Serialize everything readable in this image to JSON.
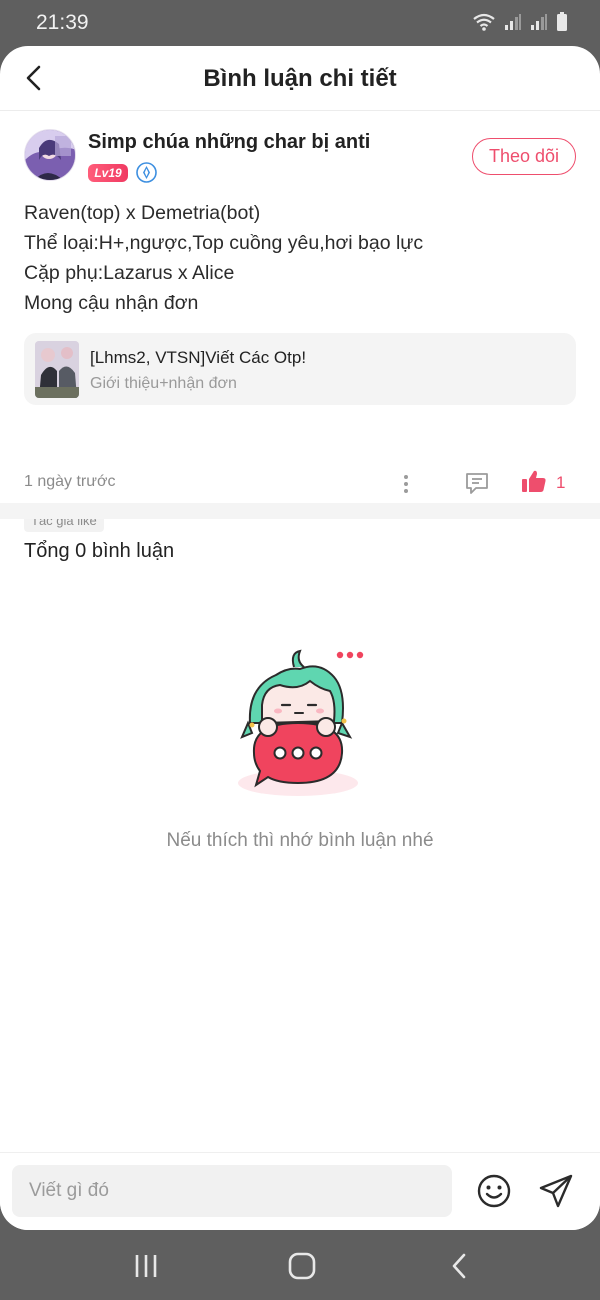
{
  "status_bar": {
    "time": "21:39",
    "icons": [
      "wifi-icon",
      "signal-icon",
      "signal-icon",
      "battery-icon"
    ]
  },
  "header": {
    "title": "Bình luận chi tiết",
    "back_icon": "chevron-left-icon"
  },
  "post": {
    "username": "Simp chúa những char bị anti",
    "level": "Lv19",
    "verify_icon": "verified-badge-icon",
    "follow_label": "Theo dõi",
    "body_lines": [
      "Raven(top) x Demetria(bot)",
      "Thể loại:H+,ngược,Top cuồng yêu,hơi bạo lực",
      "Cặp phụ:Lazarus x Alice",
      "Mong cậu nhận đơn"
    ],
    "link_card": {
      "title": "[Lhms2, VTSN]Viết Các Otp!",
      "subtitle": "Giới thiệu+nhận đơn"
    },
    "time_ago": "1 ngày trước",
    "like_count": "1",
    "author_like_tag": "Tác giả like"
  },
  "comments": {
    "total_label": "Tổng 0 bình luận",
    "empty_text": "Nếu thích thì nhớ bình luận nhé"
  },
  "composer": {
    "placeholder": "Viết gì đó",
    "emoji_icon": "emoji-icon",
    "send_icon": "send-icon"
  },
  "colors": {
    "accent": "#ee4e6d",
    "mascot_hair": "#5fd6b0",
    "mascot_bubble": "#f0445e"
  }
}
